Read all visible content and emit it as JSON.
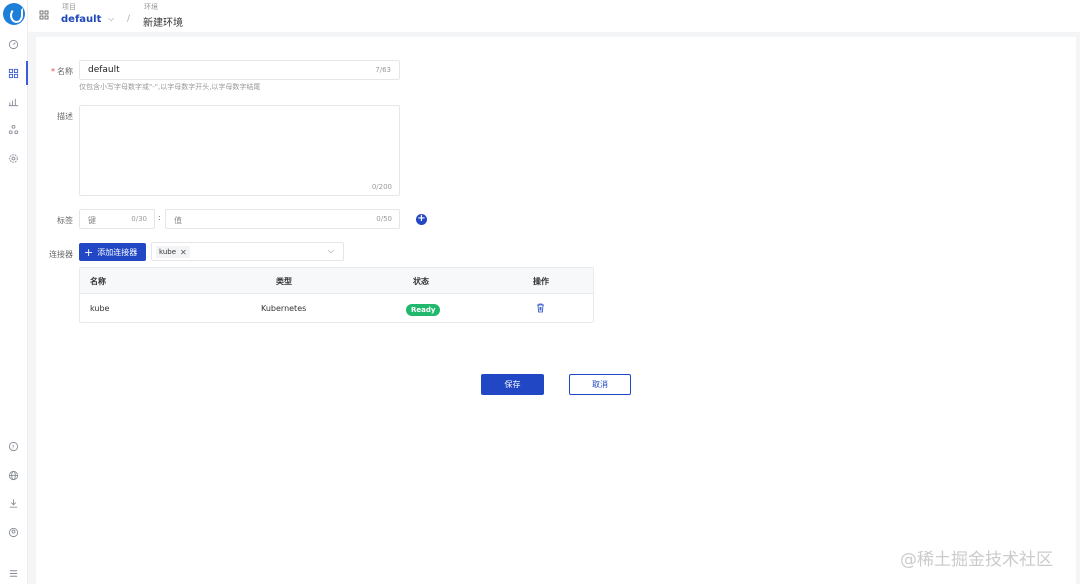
{
  "header": {
    "project_label": "项目",
    "project_value": "default",
    "env_label": "环境",
    "env_value": "新建环境",
    "separator": "/"
  },
  "sidebar": {
    "top_items": [
      "dashboard-icon",
      "apps-icon",
      "chart-icon",
      "nodes-icon",
      "gear-icon"
    ],
    "bottom_items": [
      "help-icon",
      "globe-icon",
      "download-icon",
      "user-icon",
      "menu-icon"
    ]
  },
  "form": {
    "name": {
      "label": "名称",
      "value": "default",
      "counter": "7/63",
      "hint": "仅包含小写字母数字或\"-\",以字母数字开头,以字母数字结尾"
    },
    "description": {
      "label": "描述",
      "value": "",
      "counter": "0/200"
    },
    "tags": {
      "label": "标签",
      "key_placeholder": "键",
      "key_counter": "0/30",
      "colon": ":",
      "value_placeholder": "值",
      "value_counter": "0/50"
    },
    "connector": {
      "label": "连接器",
      "add_button": "添加连接器",
      "selected_tag": "kube"
    }
  },
  "table": {
    "columns": [
      "名称",
      "类型",
      "状态",
      "操作"
    ],
    "rows": [
      {
        "name": "kube",
        "type": "Kubernetes",
        "status": "Ready"
      }
    ]
  },
  "actions": {
    "save": "保存",
    "cancel": "取消"
  },
  "watermark": "@稀土掘金技术社区",
  "colors": {
    "accent": "#2147c5",
    "ready": "#1fb86c",
    "required": "#e54545"
  }
}
